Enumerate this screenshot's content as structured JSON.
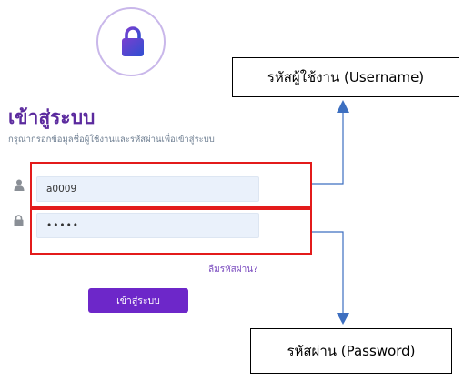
{
  "logo": {
    "icon": "lock-icon",
    "ring_color": "#c9b7ea",
    "gradient": [
      "#7a3fd0",
      "#2e4fd1"
    ]
  },
  "login": {
    "title": "เข้าสู่ระบบ",
    "subtitle": "กรุณากรอกข้อมูลชื่อผู้ใช้งานและรหัสผ่านเพื่อเข้าสู่ระบบ",
    "username_value": "a0009",
    "password_value": "•••••",
    "forgot_label": "ลืมรหัสผ่าน?",
    "submit_label": "เข้าสู่ระบบ"
  },
  "annotations": {
    "username_label": "รหัสผู้ใช้งาน (Username)",
    "password_label": "รหัสผ่าน (Password)",
    "highlight_color": "#e31b1b",
    "arrow_color": "#3d6fc0"
  },
  "colors": {
    "accent": "#6d27c9",
    "title": "#5b2a9e",
    "input_bg": "#eaf1fb"
  }
}
